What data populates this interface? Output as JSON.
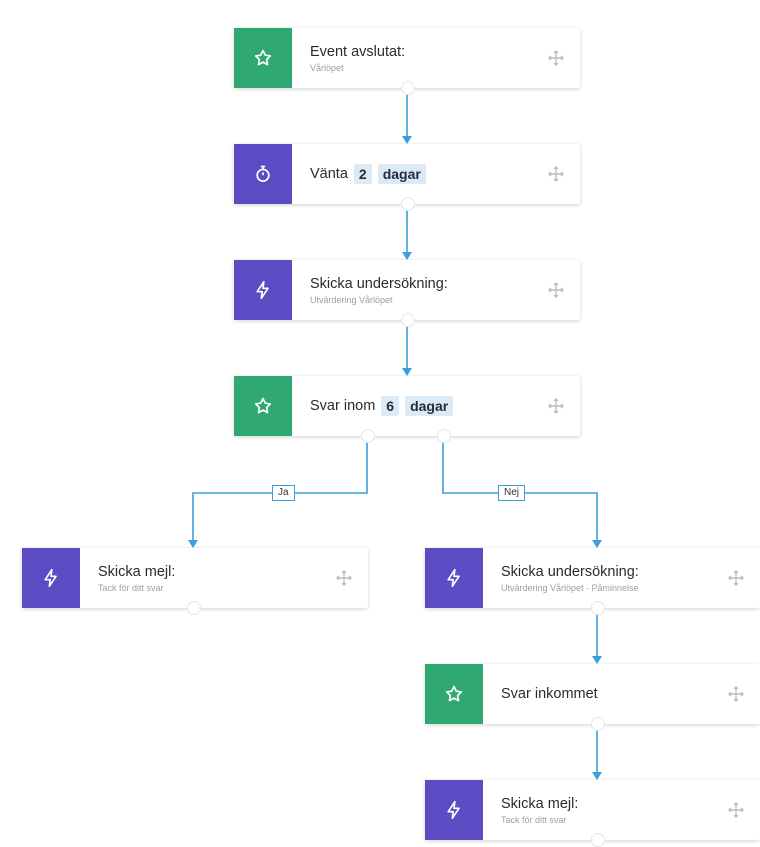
{
  "nodes": {
    "n1": {
      "title": "Event avslutat:",
      "sub": "Vårlöpet",
      "icon": "star-icon",
      "color": "#2fa872"
    },
    "n2": {
      "prefix": "Vänta",
      "value": "2",
      "unit": "dagar",
      "icon": "timer-icon",
      "color": "#5b4cc4"
    },
    "n3": {
      "title": "Skicka undersökning:",
      "sub": "Utvärdering Vårlöpet",
      "icon": "bolt-icon",
      "color": "#5b4cc4"
    },
    "n4": {
      "prefix": "Svar inom",
      "value": "6",
      "unit": "dagar",
      "icon": "star-icon",
      "color": "#2fa872"
    },
    "n5": {
      "title": "Skicka mejl:",
      "sub": "Tack för ditt svar",
      "icon": "bolt-icon",
      "color": "#5b4cc4"
    },
    "n6": {
      "title": "Skicka undersökning:",
      "sub": "Utvärdering Vårlöpet - Påminnelse",
      "icon": "bolt-icon",
      "color": "#5b4cc4"
    },
    "n7": {
      "title": "Svar inkommet",
      "icon": "star-icon",
      "color": "#2fa872"
    },
    "n8": {
      "title": "Skicka mejl:",
      "sub": "Tack för ditt svar",
      "icon": "bolt-icon",
      "color": "#5b4cc4"
    }
  },
  "branches": {
    "yes": "Ja",
    "no": "Nej"
  },
  "accent": "#3aa0da"
}
